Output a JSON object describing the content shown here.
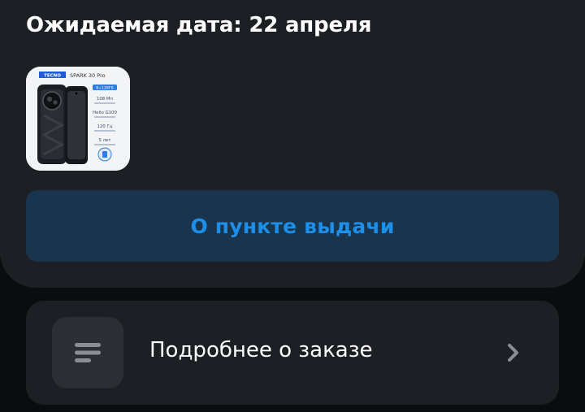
{
  "order": {
    "eta_title": "Ожидаемая дата: 22 апреля",
    "product_image": {
      "brand": "TECNO",
      "model": "SPARK 30 Pro",
      "spec_badge": "8+128ГБ",
      "specs": [
        "108 Мп",
        "Helio G100",
        "120 Гц",
        "5 лет"
      ]
    },
    "pickup_button_label": "О пункте выдачи"
  },
  "details": {
    "label": "Подробнее о заказе",
    "icon": "list-icon",
    "arrow_icon": "chevron-right-icon"
  },
  "colors": {
    "background": "#0b0c0e",
    "card": "#1c1f23",
    "accent": "#1d8fe8",
    "accent_bg": "#19354d",
    "icon_box": "#2b2e33"
  }
}
